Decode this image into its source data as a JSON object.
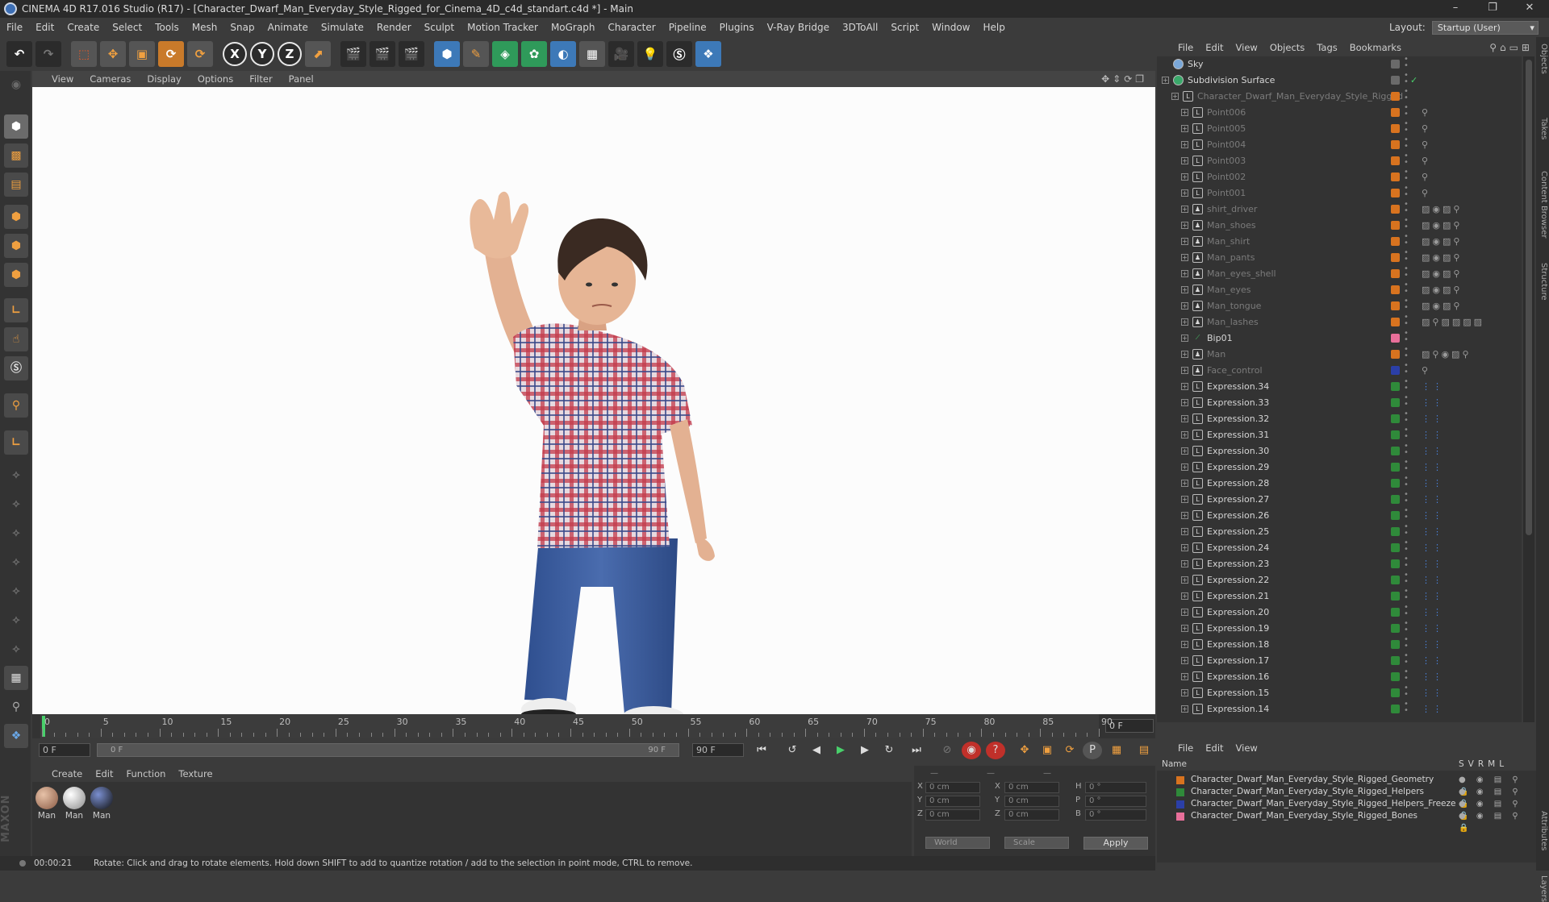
{
  "window": {
    "title": "CINEMA 4D R17.016 Studio (R17) - [Character_Dwarf_Man_Everyday_Style_Rigged_for_Cinema_4D_c4d_standart.c4d *] - Main"
  },
  "menu": [
    "File",
    "Edit",
    "Create",
    "Select",
    "Tools",
    "Mesh",
    "Snap",
    "Animate",
    "Simulate",
    "Render",
    "Sculpt",
    "Motion Tracker",
    "MoGraph",
    "Character",
    "Pipeline",
    "Plugins",
    "V-Ray Bridge",
    "3DToAll",
    "Script",
    "Window",
    "Help"
  ],
  "layout": {
    "label": "Layout:",
    "value": "Startup (User)"
  },
  "toolbar_axes": [
    "X",
    "Y",
    "Z"
  ],
  "viewport": {
    "menu": [
      "View",
      "Cameras",
      "Display",
      "Options",
      "Filter",
      "Panel"
    ]
  },
  "timeline": {
    "ticks": [
      "0",
      "5",
      "10",
      "15",
      "20",
      "25",
      "30",
      "35",
      "40",
      "45",
      "50",
      "55",
      "60",
      "65",
      "70",
      "75",
      "80",
      "85",
      "90"
    ],
    "current_frame": "0 F"
  },
  "transport": {
    "start": "0 F",
    "range_start": "0 F",
    "range_end": "90 F",
    "end": "90 F"
  },
  "materials": {
    "menu": [
      "Create",
      "Edit",
      "Function",
      "Texture"
    ],
    "items": [
      "Man",
      "Man",
      "Man"
    ]
  },
  "coords": {
    "rows": [
      {
        "a": "X",
        "av": "0 cm",
        "b": "X",
        "bv": "0 cm",
        "c": "H",
        "cv": "0 °"
      },
      {
        "a": "Y",
        "av": "0 cm",
        "b": "Y",
        "bv": "0 cm",
        "c": "P",
        "cv": "0 °"
      },
      {
        "a": "Z",
        "av": "0 cm",
        "b": "Z",
        "bv": "0 cm",
        "c": "B",
        "cv": "0 °"
      }
    ],
    "space": "World",
    "mode": "Scale",
    "apply": "Apply"
  },
  "status": {
    "time": "00:00:21",
    "text": "Rotate: Click and drag to rotate elements. Hold down SHIFT to add to quantize rotation / add to the selection in point mode, CTRL to remove."
  },
  "objects": {
    "menu": [
      "File",
      "Edit",
      "View",
      "Objects",
      "Tags",
      "Bookmarks"
    ],
    "rows": [
      {
        "name": "Sky",
        "indent": 0,
        "dim": false,
        "swatch": "#6a6a6a",
        "tags": ""
      },
      {
        "name": "Subdivision Surface",
        "indent": 0,
        "dim": false,
        "swatch": "#6a6a6a",
        "tags": "✓"
      },
      {
        "name": "Character_Dwarf_Man_Everyday_Style_Rigged",
        "indent": 1,
        "dim": true,
        "swatch": "#d8731f",
        "tags": ""
      },
      {
        "name": "Point006",
        "indent": 2,
        "dim": true,
        "swatch": "#d8731f",
        "tags": "⚲"
      },
      {
        "name": "Point005",
        "indent": 2,
        "dim": true,
        "swatch": "#d8731f",
        "tags": "⚲"
      },
      {
        "name": "Point004",
        "indent": 2,
        "dim": true,
        "swatch": "#d8731f",
        "tags": "⚲"
      },
      {
        "name": "Point003",
        "indent": 2,
        "dim": true,
        "swatch": "#d8731f",
        "tags": "⚲"
      },
      {
        "name": "Point002",
        "indent": 2,
        "dim": true,
        "swatch": "#d8731f",
        "tags": "⚲"
      },
      {
        "name": "Point001",
        "indent": 2,
        "dim": true,
        "swatch": "#d8731f",
        "tags": "⚲"
      },
      {
        "name": "shirt_driver",
        "indent": 2,
        "dim": true,
        "swatch": "#d8731f",
        "tags": "▨◉▨⚲"
      },
      {
        "name": "Man_shoes",
        "indent": 2,
        "dim": true,
        "swatch": "#d8731f",
        "tags": "▨◉▨⚲"
      },
      {
        "name": "Man_shirt",
        "indent": 2,
        "dim": true,
        "swatch": "#d8731f",
        "tags": "▨◉▨⚲"
      },
      {
        "name": "Man_pants",
        "indent": 2,
        "dim": true,
        "swatch": "#d8731f",
        "tags": "▨◉▨⚲"
      },
      {
        "name": "Man_eyes_shell",
        "indent": 2,
        "dim": true,
        "swatch": "#d8731f",
        "tags": "▨◉▨⚲"
      },
      {
        "name": "Man_eyes",
        "indent": 2,
        "dim": true,
        "swatch": "#d8731f",
        "tags": "▨◉▨⚲"
      },
      {
        "name": "Man_tongue",
        "indent": 2,
        "dim": true,
        "swatch": "#d8731f",
        "tags": "▨◉▨⚲"
      },
      {
        "name": "Man_lashes",
        "indent": 2,
        "dim": true,
        "swatch": "#d8731f",
        "tags": "▨⚲▨▨▨▨"
      },
      {
        "name": "Bip01",
        "indent": 2,
        "dim": false,
        "swatch": "#e86f9a",
        "tags": ""
      },
      {
        "name": "Man",
        "indent": 2,
        "dim": true,
        "swatch": "#d8731f",
        "tags": "▨⚲◉▨⚲"
      },
      {
        "name": "Face_control",
        "indent": 2,
        "dim": true,
        "swatch": "#2b3fa8",
        "tags": "⚲"
      },
      {
        "name": "Expression.34",
        "indent": 2,
        "dim": false,
        "swatch": "#2f8a3a",
        "tags": "⋮⋮",
        "blue": true
      },
      {
        "name": "Expression.33",
        "indent": 2,
        "dim": false,
        "swatch": "#2f8a3a",
        "tags": "⋮⋮",
        "blue": true
      },
      {
        "name": "Expression.32",
        "indent": 2,
        "dim": false,
        "swatch": "#2f8a3a",
        "tags": "⋮⋮",
        "blue": true
      },
      {
        "name": "Expression.31",
        "indent": 2,
        "dim": false,
        "swatch": "#2f8a3a",
        "tags": "⋮⋮",
        "blue": true
      },
      {
        "name": "Expression.30",
        "indent": 2,
        "dim": false,
        "swatch": "#2f8a3a",
        "tags": "⋮⋮",
        "blue": true
      },
      {
        "name": "Expression.29",
        "indent": 2,
        "dim": false,
        "swatch": "#2f8a3a",
        "tags": "⋮⋮",
        "blue": true
      },
      {
        "name": "Expression.28",
        "indent": 2,
        "dim": false,
        "swatch": "#2f8a3a",
        "tags": "⋮⋮",
        "blue": true
      },
      {
        "name": "Expression.27",
        "indent": 2,
        "dim": false,
        "swatch": "#2f8a3a",
        "tags": "⋮⋮",
        "blue": true
      },
      {
        "name": "Expression.26",
        "indent": 2,
        "dim": false,
        "swatch": "#2f8a3a",
        "tags": "⋮⋮",
        "blue": true
      },
      {
        "name": "Expression.25",
        "indent": 2,
        "dim": false,
        "swatch": "#2f8a3a",
        "tags": "⋮⋮",
        "blue": true
      },
      {
        "name": "Expression.24",
        "indent": 2,
        "dim": false,
        "swatch": "#2f8a3a",
        "tags": "⋮⋮",
        "blue": true
      },
      {
        "name": "Expression.23",
        "indent": 2,
        "dim": false,
        "swatch": "#2f8a3a",
        "tags": "⋮⋮",
        "blue": true
      },
      {
        "name": "Expression.22",
        "indent": 2,
        "dim": false,
        "swatch": "#2f8a3a",
        "tags": "⋮⋮",
        "blue": true
      },
      {
        "name": "Expression.21",
        "indent": 2,
        "dim": false,
        "swatch": "#2f8a3a",
        "tags": "⋮⋮",
        "blue": true
      },
      {
        "name": "Expression.20",
        "indent": 2,
        "dim": false,
        "swatch": "#2f8a3a",
        "tags": "⋮⋮",
        "blue": true
      },
      {
        "name": "Expression.19",
        "indent": 2,
        "dim": false,
        "swatch": "#2f8a3a",
        "tags": "⋮⋮",
        "blue": true
      },
      {
        "name": "Expression.18",
        "indent": 2,
        "dim": false,
        "swatch": "#2f8a3a",
        "tags": "⋮⋮",
        "blue": true
      },
      {
        "name": "Expression.17",
        "indent": 2,
        "dim": false,
        "swatch": "#2f8a3a",
        "tags": "⋮⋮",
        "blue": true
      },
      {
        "name": "Expression.16",
        "indent": 2,
        "dim": false,
        "swatch": "#2f8a3a",
        "tags": "⋮⋮",
        "blue": true
      },
      {
        "name": "Expression.15",
        "indent": 2,
        "dim": false,
        "swatch": "#2f8a3a",
        "tags": "⋮⋮",
        "blue": true
      },
      {
        "name": "Expression.14",
        "indent": 2,
        "dim": false,
        "swatch": "#2f8a3a",
        "tags": "⋮⋮",
        "blue": true
      }
    ]
  },
  "layers": {
    "menu": [
      "File",
      "Edit",
      "View"
    ],
    "columns": {
      "name": "Name",
      "flags": [
        "S",
        "V",
        "R",
        "M",
        "L"
      ]
    },
    "rows": [
      {
        "name": "Character_Dwarf_Man_Everyday_Style_Rigged_Geometry",
        "color": "#d8731f"
      },
      {
        "name": "Character_Dwarf_Man_Everyday_Style_Rigged_Helpers",
        "color": "#2f8a3a"
      },
      {
        "name": "Character_Dwarf_Man_Everyday_Style_Rigged_Helpers_Freeze",
        "color": "#2b3fa8"
      },
      {
        "name": "Character_Dwarf_Man_Everyday_Style_Rigged_Bones",
        "color": "#e86f9a"
      }
    ]
  },
  "side_tabs": [
    "Objects",
    "Takes",
    "Content Browser",
    "Structure",
    "Attributes",
    "Layers"
  ]
}
